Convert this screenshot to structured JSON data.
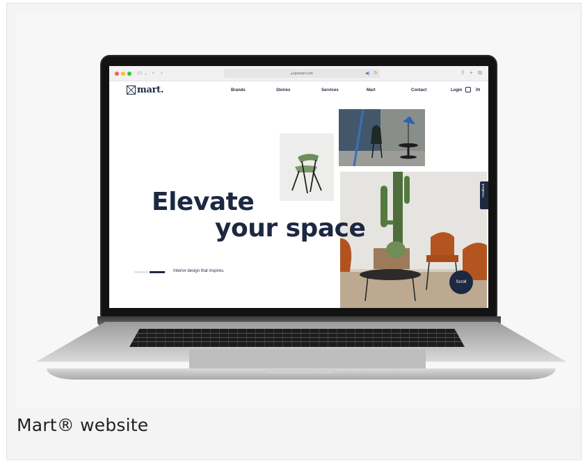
{
  "browser": {
    "url": "kpsmart.com",
    "traffic_lights": [
      "#ff5f57",
      "#febc2e",
      "#28c840"
    ]
  },
  "site": {
    "logo_text": "mart.",
    "nav": [
      "Brands",
      "Stories",
      "Services",
      "Mart",
      "Contact"
    ],
    "login": "Login",
    "social": [
      "instagram-icon",
      "linkedin-icon"
    ],
    "linkedin_label": "in",
    "hero_line1": "Elevate",
    "hero_line2": "your space",
    "tagline": "Interior design that inspires.",
    "feedback": "Feedback",
    "scroll": "Scroll",
    "accent": "#1d2841"
  },
  "caption": "Mart® website"
}
